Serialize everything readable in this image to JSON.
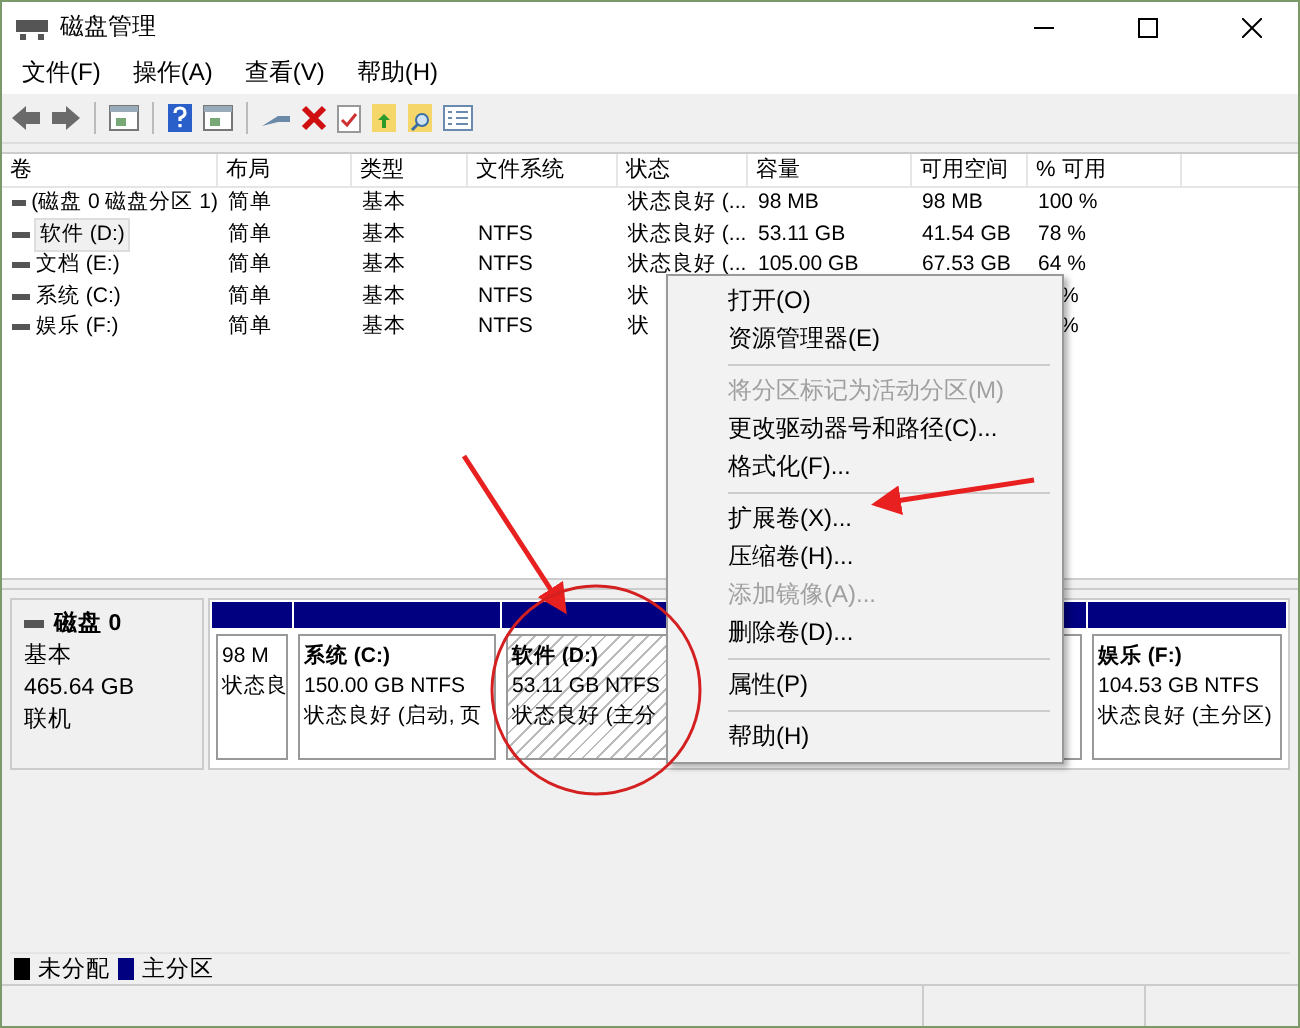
{
  "window": {
    "title": "磁盘管理"
  },
  "menu": [
    "文件(F)",
    "操作(A)",
    "查看(V)",
    "帮助(H)"
  ],
  "table": {
    "columns": [
      "卷",
      "布局",
      "类型",
      "文件系统",
      "状态",
      "容量",
      "可用空间",
      "% 可用"
    ],
    "rows": [
      {
        "volume": "(磁盘 0 磁盘分区 1)",
        "layout": "简单",
        "type": "基本",
        "status": "状态良好 (...",
        "capacity": "98 MB",
        "free": "98 MB",
        "pct": "100 %",
        "selected": false
      },
      {
        "volume": "软件 (D:)",
        "layout": "简单",
        "type": "基本",
        "fs": "NTFS",
        "status": "状态良好 (...",
        "capacity": "53.11 GB",
        "free": "41.54 GB",
        "pct": "78 %",
        "selected": true
      },
      {
        "volume": "文档 (E:)",
        "layout": "简单",
        "type": "基本",
        "fs": "NTFS",
        "status": "状态良好 (...",
        "capacity": "105.00 GB",
        "free": "67.53 GB",
        "pct": "64 %",
        "selected": false
      },
      {
        "volume": "系统 (C:)",
        "layout": "简单",
        "type": "基本",
        "fs": "NTFS",
        "status": "状",
        "pct": "%",
        "selected": false
      },
      {
        "volume": "娱乐 (F:)",
        "layout": "简单",
        "type": "基本",
        "fs": "NTFS",
        "status": "状",
        "pct": "%",
        "selected": false
      }
    ]
  },
  "disk": {
    "name": "磁盘 0",
    "type": "基本",
    "size": "465.64 GB",
    "state": "联机",
    "partitions": [
      {
        "lines": [
          "98 M",
          "状态良"
        ],
        "selected": false
      },
      {
        "name": "系统 (C:)",
        "lines": [
          "150.00 GB NTFS",
          "状态良好 (启动, 页"
        ],
        "selected": false
      },
      {
        "name": "软件 (D:)",
        "lines": [
          "53.11 GB NTFS",
          "状态良好 (主分"
        ],
        "selected": true
      },
      {
        "selected": false
      },
      {
        "name": "娱乐 (F:)",
        "lines": [
          "104.53 GB NTFS",
          "状态良好 (主分区)"
        ],
        "selected": false
      }
    ]
  },
  "context_menu": [
    {
      "kind": "item",
      "label": "打开(O)",
      "disabled": false
    },
    {
      "kind": "item",
      "label": "资源管理器(E)",
      "disabled": false
    },
    {
      "kind": "separator"
    },
    {
      "kind": "item",
      "label": "将分区标记为活动分区(M)",
      "disabled": true
    },
    {
      "kind": "item",
      "label": "更改驱动器号和路径(C)...",
      "disabled": false
    },
    {
      "kind": "item",
      "label": "格式化(F)...",
      "disabled": false
    },
    {
      "kind": "separator"
    },
    {
      "kind": "item",
      "label": "扩展卷(X)...",
      "disabled": false
    },
    {
      "kind": "item",
      "label": "压缩卷(H)...",
      "disabled": false
    },
    {
      "kind": "item",
      "label": "添加镜像(A)...",
      "disabled": true
    },
    {
      "kind": "item",
      "label": "删除卷(D)...",
      "disabled": false
    },
    {
      "kind": "separator"
    },
    {
      "kind": "item",
      "label": "属性(P)",
      "disabled": false
    },
    {
      "kind": "separator"
    },
    {
      "kind": "item",
      "label": "帮助(H)",
      "disabled": false
    }
  ],
  "legend": [
    {
      "label": "未分配",
      "color": "#000000"
    },
    {
      "label": "主分区",
      "color": "#000080"
    }
  ]
}
